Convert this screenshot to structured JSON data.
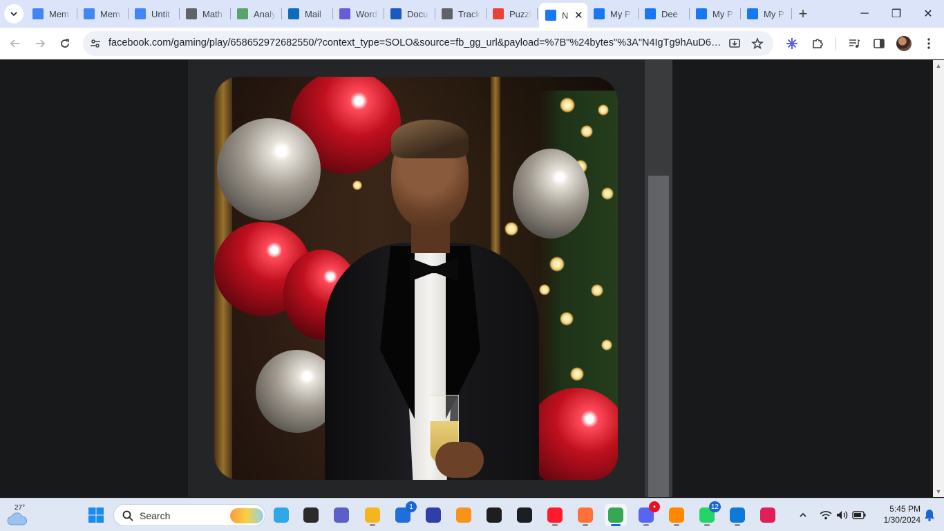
{
  "browser": {
    "tabs": [
      {
        "title": "Mem",
        "favicon": "google-docs-icon",
        "color": "#4285f4"
      },
      {
        "title": "Mem",
        "favicon": "google-docs-icon",
        "color": "#4285f4"
      },
      {
        "title": "Untit",
        "favicon": "google-docs-icon",
        "color": "#4285f4"
      },
      {
        "title": "Math",
        "favicon": "globe-icon",
        "color": "#5f6368"
      },
      {
        "title": "Analy",
        "favicon": "robot-icon",
        "color": "#5aa36b"
      },
      {
        "title": "Mail",
        "favicon": "outlook-icon",
        "color": "#0f6cbd"
      },
      {
        "title": "Word",
        "favicon": "copilot-icon",
        "color": "#6b5bd6"
      },
      {
        "title": "Docu",
        "favicon": "word-icon",
        "color": "#185abd"
      },
      {
        "title": "Track",
        "favicon": "tracker-icon",
        "color": "#5f6368"
      },
      {
        "title": "Puzzl",
        "favicon": "gmail-icon",
        "color": "#ea4335"
      },
      {
        "title": "N",
        "favicon": "facebook-games-icon",
        "color": "#1877f2",
        "active": true
      },
      {
        "title": "My P",
        "favicon": "facebook-games-icon",
        "color": "#1877f2"
      },
      {
        "title": "Dee",
        "favicon": "facebook-games-icon",
        "color": "#1877f2"
      },
      {
        "title": "My P",
        "favicon": "facebook-games-icon",
        "color": "#1877f2"
      },
      {
        "title": "My P",
        "favicon": "facebook-games-icon",
        "color": "#1877f2"
      }
    ],
    "new_tab_label": "+",
    "url": "facebook.com/gaming/play/658652972682550/?context_type=SOLO&source=fb_gg_url&payload=%7B\"%24bytes\"%3A\"N4IgTg9hAuD6CWATE..."
  },
  "window_controls": {
    "minimize": "─",
    "restore": "❐",
    "close": "✕"
  },
  "taskbar": {
    "weather_temp": "27°",
    "search_placeholder": "Search",
    "apps": [
      {
        "name": "copilot-icon",
        "color": "#2fa7e8"
      },
      {
        "name": "task-view-icon",
        "color": "#2b2b2b"
      },
      {
        "name": "teams-chat-icon",
        "color": "#5b5fc7"
      },
      {
        "name": "file-explorer-icon",
        "color": "#f3b61f"
      },
      {
        "name": "microsoft-store-icon",
        "color": "#1e6fd9",
        "badge": "1"
      },
      {
        "name": "math-app-icon",
        "color": "#2f3fa8"
      },
      {
        "name": "bitcoin-wallet-icon",
        "color": "#f7931a"
      },
      {
        "name": "figma-icon",
        "color": "#1e1e1e"
      },
      {
        "name": "github-icon",
        "color": "#1b1f23"
      },
      {
        "name": "opera-icon",
        "color": "#ff1b2d"
      },
      {
        "name": "firefox-icon",
        "color": "#ff7139"
      },
      {
        "name": "chrome-icon",
        "color": "#34a853",
        "active": true
      },
      {
        "name": "discord-icon",
        "color": "#5865f2",
        "badge": "•"
      },
      {
        "name": "vlc-icon",
        "color": "#ff8800"
      },
      {
        "name": "whatsapp-icon",
        "color": "#25d366",
        "badge": "12"
      },
      {
        "name": "edge-icon",
        "color": "#0c7ad9"
      },
      {
        "name": "slack-icon",
        "color": "#e01e5a"
      }
    ],
    "clock_time": "5:45 PM",
    "clock_date": "1/30/2024"
  },
  "colors": {
    "accent": "#1a73e8",
    "tabstrip": "#dbe4f9",
    "page_bg": "#18191a"
  }
}
